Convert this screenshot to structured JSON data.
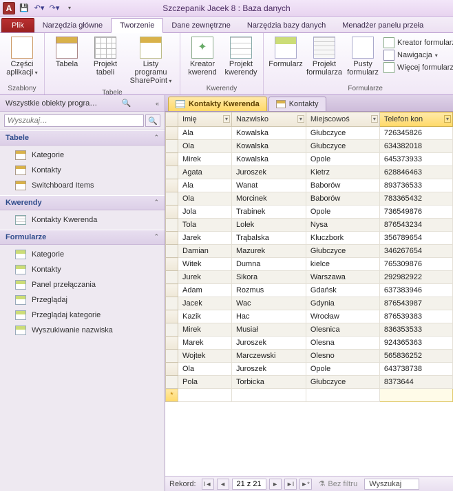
{
  "title": "Szczepanik Jacek 8 : Baza danych",
  "ribbon_tabs": {
    "file": "Plik",
    "items": [
      "Narzędzia główne",
      "Tworzenie",
      "Dane zewnętrzne",
      "Narzędzia bazy danych",
      "Menadżer panelu przeła"
    ],
    "active_index": 1
  },
  "ribbon": {
    "szablony": {
      "label": "Szablony",
      "czesci": "Części aplikacji"
    },
    "tabele": {
      "label": "Tabele",
      "tabela": "Tabela",
      "projekt": "Projekt tabeli",
      "sp": "Listy programu SharePoint"
    },
    "kwerendy": {
      "label": "Kwerendy",
      "kreator": "Kreator kwerend",
      "projekt": "Projekt kwerendy"
    },
    "formularze": {
      "label": "Formularze",
      "form": "Formularz",
      "projekt": "Projekt formularza",
      "pusty": "Pusty formularz",
      "kreator": "Kreator formularzy",
      "nawigacja": "Nawigacja",
      "wiecej": "Więcej formularzy"
    }
  },
  "nav": {
    "header": "Wszystkie obiekty progra…",
    "search_placeholder": "Wyszukaj…",
    "cats": {
      "tabele": "Tabele",
      "kwerendy": "Kwerendy",
      "formularze": "Formularze"
    },
    "tabele": [
      "Kategorie",
      "Kontakty",
      "Switchboard Items"
    ],
    "kwerendy": [
      "Kontakty Kwerenda"
    ],
    "formularze": [
      "Kategorie",
      "Kontakty",
      "Panel przełączania",
      "Przeglądaj",
      "Przeglądaj kategorie",
      "Wyszukiwanie nazwiska"
    ]
  },
  "doc_tabs": {
    "items": [
      "Kontakty Kwerenda",
      "Kontakty"
    ],
    "active_index": 0
  },
  "columns": [
    "Imię",
    "Nazwisko",
    "Miejscowoś",
    "Telefon kon"
  ],
  "selected_col_index": 3,
  "chart_data": {
    "type": "table",
    "columns": [
      "Imię",
      "Nazwisko",
      "Miejscowość",
      "Telefon kontaktowy"
    ],
    "rows": [
      [
        "Ala",
        "Kowalska",
        "Głubczyce",
        "726345826"
      ],
      [
        "Ola",
        "Kowalska",
        "Głubczyce",
        "634382018"
      ],
      [
        "Mirek",
        "Kowalska",
        "Opole",
        "645373933"
      ],
      [
        "Agata",
        "Juroszek",
        "Kietrz",
        "628846463"
      ],
      [
        "Ala",
        "Wanat",
        "Baborów",
        "893736533"
      ],
      [
        "Ola",
        "Morcinek",
        "Baborów",
        "783365432"
      ],
      [
        "Jola",
        "Trabinek",
        "Opole",
        "736549876"
      ],
      [
        "Tola",
        "Lolek",
        "Nysa",
        "876543234"
      ],
      [
        "Jarek",
        "Trąbalska",
        "Kluczbork",
        "356789654"
      ],
      [
        "Damian",
        "Mazurek",
        "Głubczyce",
        "346267654"
      ],
      [
        "Witek",
        "Dumna",
        "kielce",
        "765309876"
      ],
      [
        "Jurek",
        "Sikora",
        "Warszawa",
        "292982922"
      ],
      [
        "Adam",
        "Rozmus",
        "Gdańsk",
        "637383946"
      ],
      [
        "Jacek",
        "Wac",
        "Gdynia",
        "876543987"
      ],
      [
        "Kazik",
        "Hac",
        "Wrocław",
        "876539383"
      ],
      [
        "Mirek",
        "Musiał",
        "Olesnica",
        "836353533"
      ],
      [
        "Marek",
        "Juroszek",
        "Olesna",
        "924365363"
      ],
      [
        "Wojtek",
        "Marczewski",
        "Olesno",
        "565836252"
      ],
      [
        "Ola",
        "Juroszek",
        "Opole",
        "643738738"
      ],
      [
        "Pola",
        "Torbicka",
        "Głubczyce",
        "8373644"
      ]
    ]
  },
  "recnav": {
    "label": "Rekord:",
    "pos": "21 z 21",
    "filter": "Bez filtru",
    "search": "Wyszukaj"
  }
}
